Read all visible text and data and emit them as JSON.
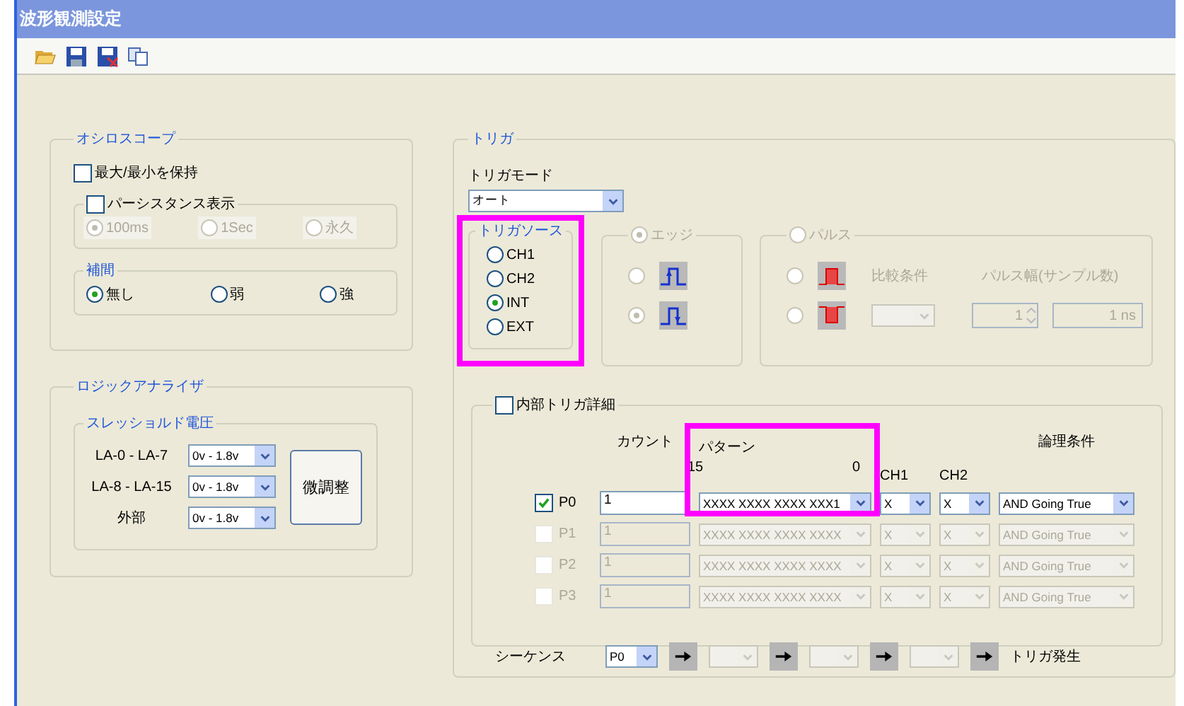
{
  "window": {
    "title": "波形観測設定"
  },
  "oscilloscope": {
    "title": "オシロスコープ",
    "hold": {
      "label": "最大/最小を保持",
      "checked": false
    },
    "persistence": {
      "label": "パーシスタンス表示",
      "checked": false,
      "options": [
        {
          "label": "100ms",
          "selected": true
        },
        {
          "label": "1Sec",
          "selected": false
        },
        {
          "label": "永久",
          "selected": false
        }
      ]
    },
    "interpolation": {
      "title": "補間",
      "options": [
        {
          "label": "無し",
          "selected": true
        },
        {
          "label": "弱",
          "selected": false
        },
        {
          "label": "強",
          "selected": false
        }
      ]
    }
  },
  "logic_analyzer": {
    "title": "ロジックアナライザ",
    "threshold": {
      "title": "スレッショルド電圧",
      "rows": [
        {
          "label": "LA-0 - LA-7",
          "value": "0v - 1.8v"
        },
        {
          "label": "LA-8 - LA-15",
          "value": "0v - 1.8v"
        },
        {
          "label": "外部",
          "value": "0v - 1.8v"
        }
      ]
    },
    "fine_tune_button": "微調整"
  },
  "trigger": {
    "title": "トリガ",
    "mode": {
      "label": "トリガモード",
      "value": "オート"
    },
    "source": {
      "title": "トリガソース",
      "highlighted": true,
      "options": [
        {
          "label": "CH1",
          "selected": false
        },
        {
          "label": "CH2",
          "selected": false
        },
        {
          "label": "INT",
          "selected": true
        },
        {
          "label": "EXT",
          "selected": false
        }
      ]
    },
    "edge": {
      "label": "エッジ",
      "selected": true,
      "disabled": true,
      "options": [
        {
          "kind": "rising",
          "selected": false
        },
        {
          "kind": "falling",
          "selected": true
        }
      ]
    },
    "pulse": {
      "label": "パルス",
      "selected": false,
      "disabled": true,
      "options": [
        {
          "kind": "positive",
          "selected": false
        },
        {
          "kind": "negative",
          "selected": false
        }
      ],
      "compare_label": "比較条件",
      "width_label": "パルス幅(サンプル数)",
      "width_count": "1",
      "width_time": "1 ns"
    },
    "internal": {
      "label": "内部トリガ詳細",
      "checked": false,
      "pattern_highlighted": true,
      "headers": {
        "count": "カウント",
        "pattern": "パターン",
        "bit_high": "15",
        "bit_low": "0",
        "ch1": "CH1",
        "ch2": "CH2",
        "logic": "論理条件"
      },
      "rows": [
        {
          "label": "P0",
          "checked": true,
          "disabled": false,
          "count": "1",
          "pattern": "XXXX XXXX XXXX XXX1",
          "ch1": "X",
          "ch2": "X",
          "logic": "AND Going True"
        },
        {
          "label": "P1",
          "checked": false,
          "disabled": true,
          "count": "1",
          "pattern": "XXXX XXXX XXXX XXXX",
          "ch1": "X",
          "ch2": "X",
          "logic": "AND Going True"
        },
        {
          "label": "P2",
          "checked": false,
          "disabled": true,
          "count": "1",
          "pattern": "XXXX XXXX XXXX XXXX",
          "ch1": "X",
          "ch2": "X",
          "logic": "AND Going True"
        },
        {
          "label": "P3",
          "checked": false,
          "disabled": true,
          "count": "1",
          "pattern": "XXXX XXXX XXXX XXXX",
          "ch1": "X",
          "ch2": "X",
          "logic": "AND Going True"
        }
      ],
      "sequence": {
        "label": "シーケンス",
        "end_label": "トリガ発生",
        "steps": [
          {
            "value": "P0",
            "disabled": false
          },
          {
            "disabled": true
          },
          {
            "disabled": true
          },
          {
            "disabled": true
          }
        ]
      }
    }
  }
}
